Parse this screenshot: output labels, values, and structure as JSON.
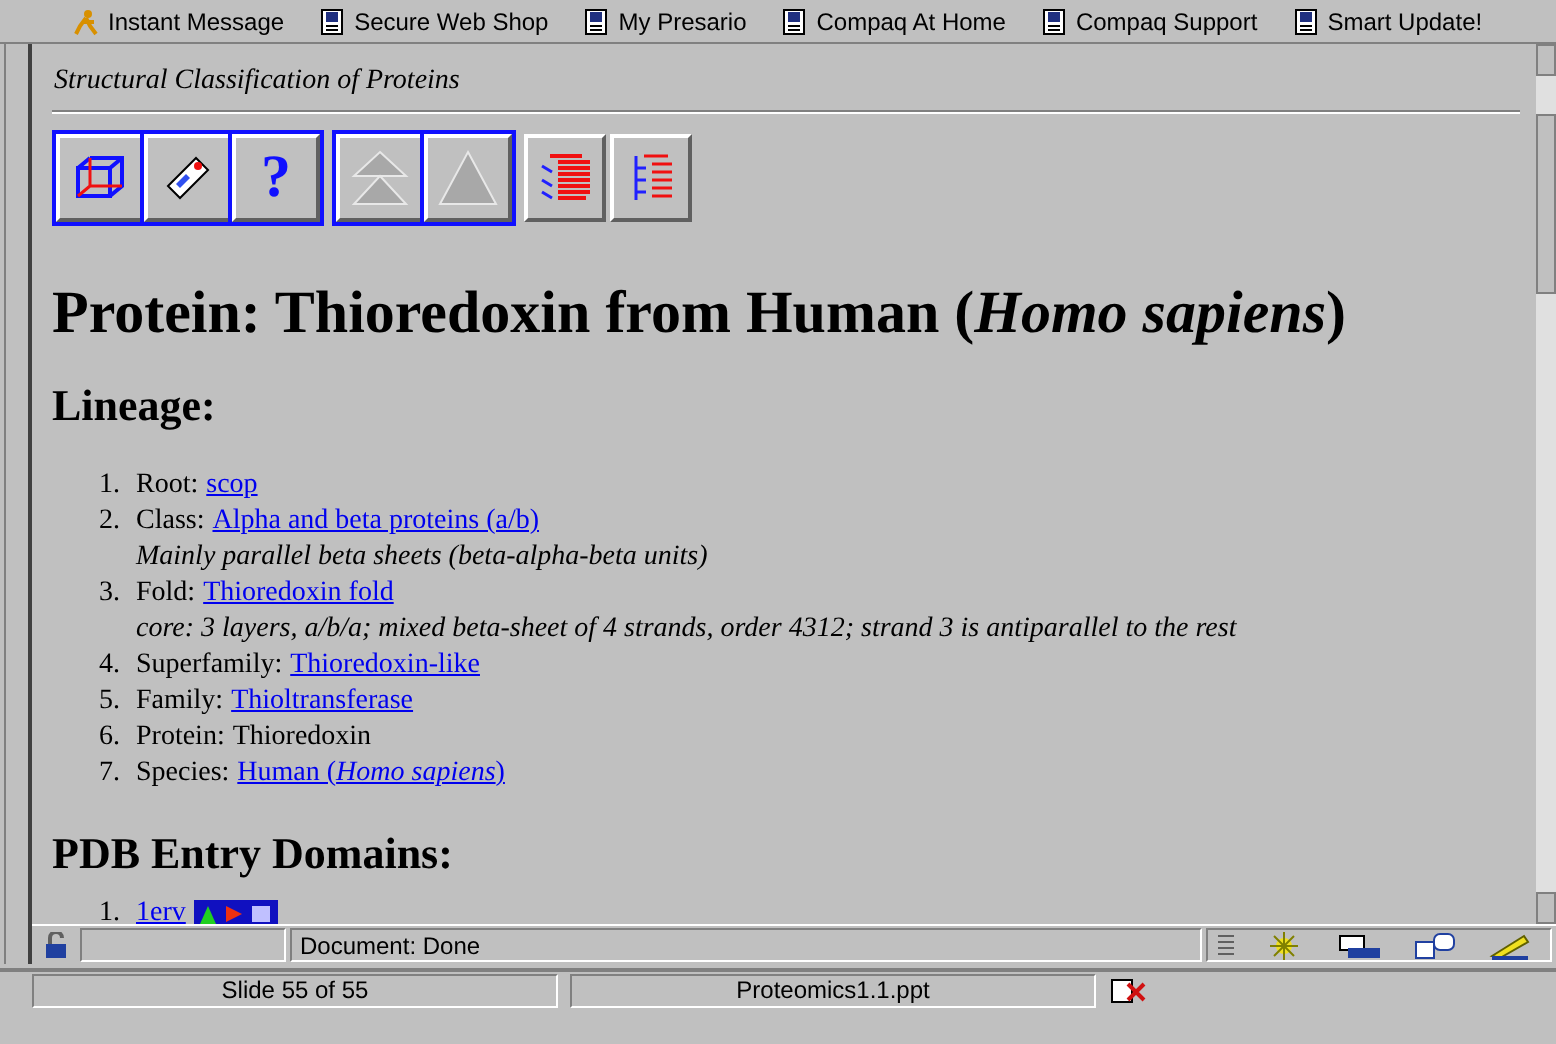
{
  "links_bar": [
    {
      "kind": "messenger",
      "label": "Instant Message"
    },
    {
      "kind": "page",
      "label": "Secure Web Shop"
    },
    {
      "kind": "page",
      "label": "My Presario"
    },
    {
      "kind": "page",
      "label": "Compaq At Home"
    },
    {
      "kind": "page",
      "label": "Compaq Support"
    },
    {
      "kind": "page",
      "label": "Smart Update!"
    }
  ],
  "site_title": "Structural Classification of Proteins",
  "toolbar": [
    {
      "framed": true,
      "buttons": [
        {
          "kind": "cube"
        },
        {
          "kind": "chip"
        },
        {
          "kind": "help",
          "label": "?"
        }
      ]
    },
    {
      "framed": true,
      "buttons": [
        {
          "kind": "up-double"
        },
        {
          "kind": "up"
        }
      ]
    },
    {
      "framed": false,
      "buttons": [
        {
          "kind": "tree-expand"
        },
        {
          "kind": "tree-collapse"
        }
      ]
    }
  ],
  "heading": "Protein: Thioredoxin from Human (*Homo sapiens*)",
  "lineage": {
    "heading": "Lineage:",
    "items": [
      {
        "number": "1.",
        "label": "Root:",
        "link": "scop"
      },
      {
        "number": "2.",
        "label": "Class:",
        "link": "Alpha and beta proteins (a/b)",
        "note": "Mainly parallel beta sheets (beta-alpha-beta units)"
      },
      {
        "number": "3.",
        "label": "Fold:",
        "link": "Thioredoxin fold",
        "note": "core: 3 layers, a/b/a; mixed beta-sheet of 4 strands, order 4312; strand 3 is antiparallel to the rest"
      },
      {
        "number": "4.",
        "label": "Superfamily:",
        "link": "Thioredoxin-like"
      },
      {
        "number": "5.",
        "label": "Family:",
        "link": "Thioltransferase"
      },
      {
        "number": "6.",
        "label": "Protein:",
        "value": "Thioredoxin"
      },
      {
        "number": "7.",
        "label": "Species:",
        "link": "Human (*Homo sapiens*)"
      }
    ]
  },
  "pdb_domains": {
    "heading": "PDB Entry Domains:",
    "items": [
      {
        "number": "1.",
        "link": "1erv"
      }
    ]
  },
  "status_bar": {
    "text": "Document: Done"
  },
  "presentation_bar": {
    "slide": "Slide 55 of 55",
    "file": "Proteomics1.1.ppt"
  }
}
